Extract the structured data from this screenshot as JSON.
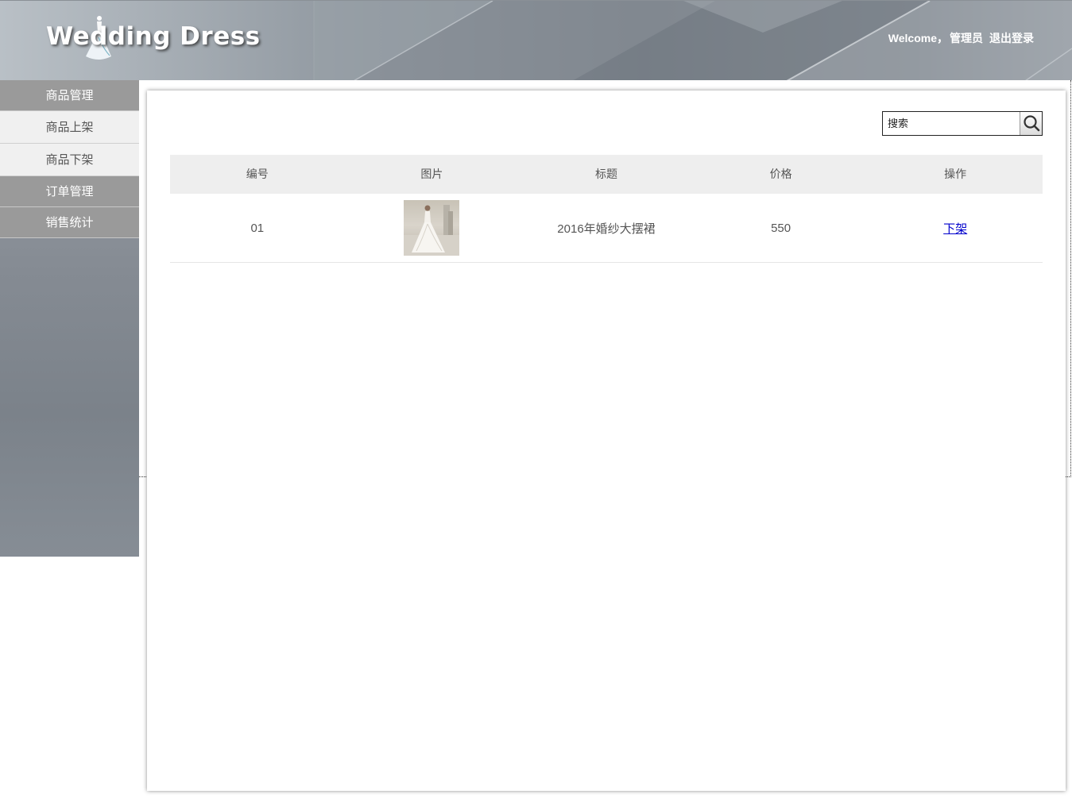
{
  "header": {
    "logo_text": "Wedding Dress",
    "welcome": "Welcome，",
    "username": "管理员",
    "logout_label": "退出登录"
  },
  "sidebar": {
    "groups": [
      {
        "label": "商品管理",
        "items": [
          {
            "label": "商品上架"
          },
          {
            "label": "商品下架"
          }
        ]
      },
      {
        "label": "订单管理",
        "items": []
      },
      {
        "label": "销售统计",
        "items": []
      }
    ]
  },
  "search": {
    "placeholder": "搜索",
    "icon": "search-icon"
  },
  "table": {
    "columns": [
      "编号",
      "图片",
      "标题",
      "价格",
      "操作"
    ],
    "rows": [
      {
        "id": "01",
        "image": "wedding-dress-thumbnail",
        "title": "2016年婚纱大摆裙",
        "price": "550",
        "action": "下架"
      }
    ]
  },
  "colors": {
    "menu_group_bg": "#9a9a9a",
    "menu_item_bg": "#f0f0f0",
    "table_header_bg": "#eeeeee",
    "link": "#0000cc"
  }
}
